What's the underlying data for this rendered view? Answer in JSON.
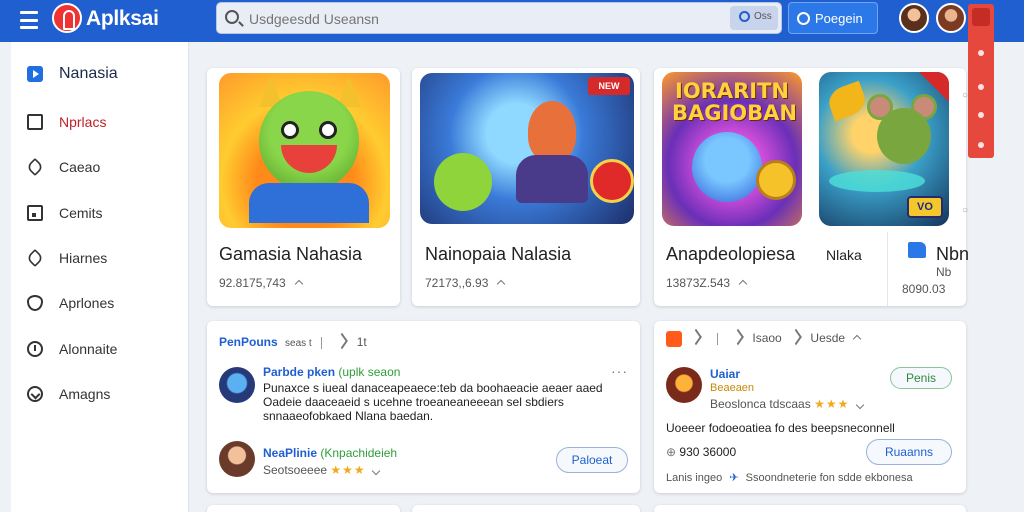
{
  "app": {
    "name": "Aplksai"
  },
  "search": {
    "placeholder": "Usdgeesdd Useansn",
    "button_label": "Oss"
  },
  "header": {
    "action_label": "Poegein"
  },
  "sidebar": {
    "items": [
      {
        "label": "Nanasia",
        "icon": "play-icon"
      },
      {
        "label": "Nprlacs",
        "icon": "square-icon"
      },
      {
        "label": "Caeao",
        "icon": "tag-icon"
      },
      {
        "label": "Cemits",
        "icon": "box-icon"
      },
      {
        "label": "Hiarnes",
        "icon": "tag-icon"
      },
      {
        "label": "Aprlones",
        "icon": "shield-icon"
      },
      {
        "label": "Alonnaite",
        "icon": "clock-icon"
      },
      {
        "label": "Amagns",
        "icon": "arrow-icon"
      }
    ]
  },
  "games": [
    {
      "title": "Gamasia Nahasia",
      "meta": "92.8175,743"
    },
    {
      "title": "Nainopaia Nalasia",
      "meta": "72173,,6.93"
    },
    {
      "title": "Anapdeolopiesa",
      "meta": "13873Z.543",
      "extra": "Nlaka",
      "banner": "IORARITN BAGIOBAN"
    },
    {
      "title": "Nbn",
      "meta": "8090.03",
      "badge": "Nb",
      "tag": "VO"
    }
  ],
  "feed": {
    "left": {
      "header": "PenPouns",
      "header_extra": "seas t",
      "count": "1t",
      "posts": [
        {
          "name": "Parbde pken",
          "tag": "(uplk seaon",
          "text": "Punaxce s iueal danaceapeaece:teb da boohaeacie aeaer aaed Oadeie daaceaeid s ucehne troeaneaneeean sel sbdiers snnaaeofobkaed Nlana baedan."
        },
        {
          "name": "NeaPlinie",
          "tag": "(Knpachideieh",
          "sub": "Seotsoeeee",
          "rating": "★★★"
        }
      ],
      "button": "Paloeat",
      "kebab": "···"
    },
    "right": {
      "header_items": [
        "Isaoo",
        "Uesde"
      ],
      "post": {
        "name": "Uaiar",
        "tag": "Beaeaen",
        "sub": "Beoslonca  tdscaas",
        "rating": "★★★"
      },
      "pill": "Penis",
      "text": "Uoeeer fodoeoatiea fo des beepsneconnell",
      "stat": "930 36000",
      "button": "Ruaanns",
      "footer_left": "Lanis ingeo",
      "footer_right": "Ssoondneterie fon  sdde ekbonesa"
    }
  },
  "colors": {
    "brand": "#1f5fd0",
    "accent_red": "#e6483d",
    "star": "#f2a91a"
  }
}
